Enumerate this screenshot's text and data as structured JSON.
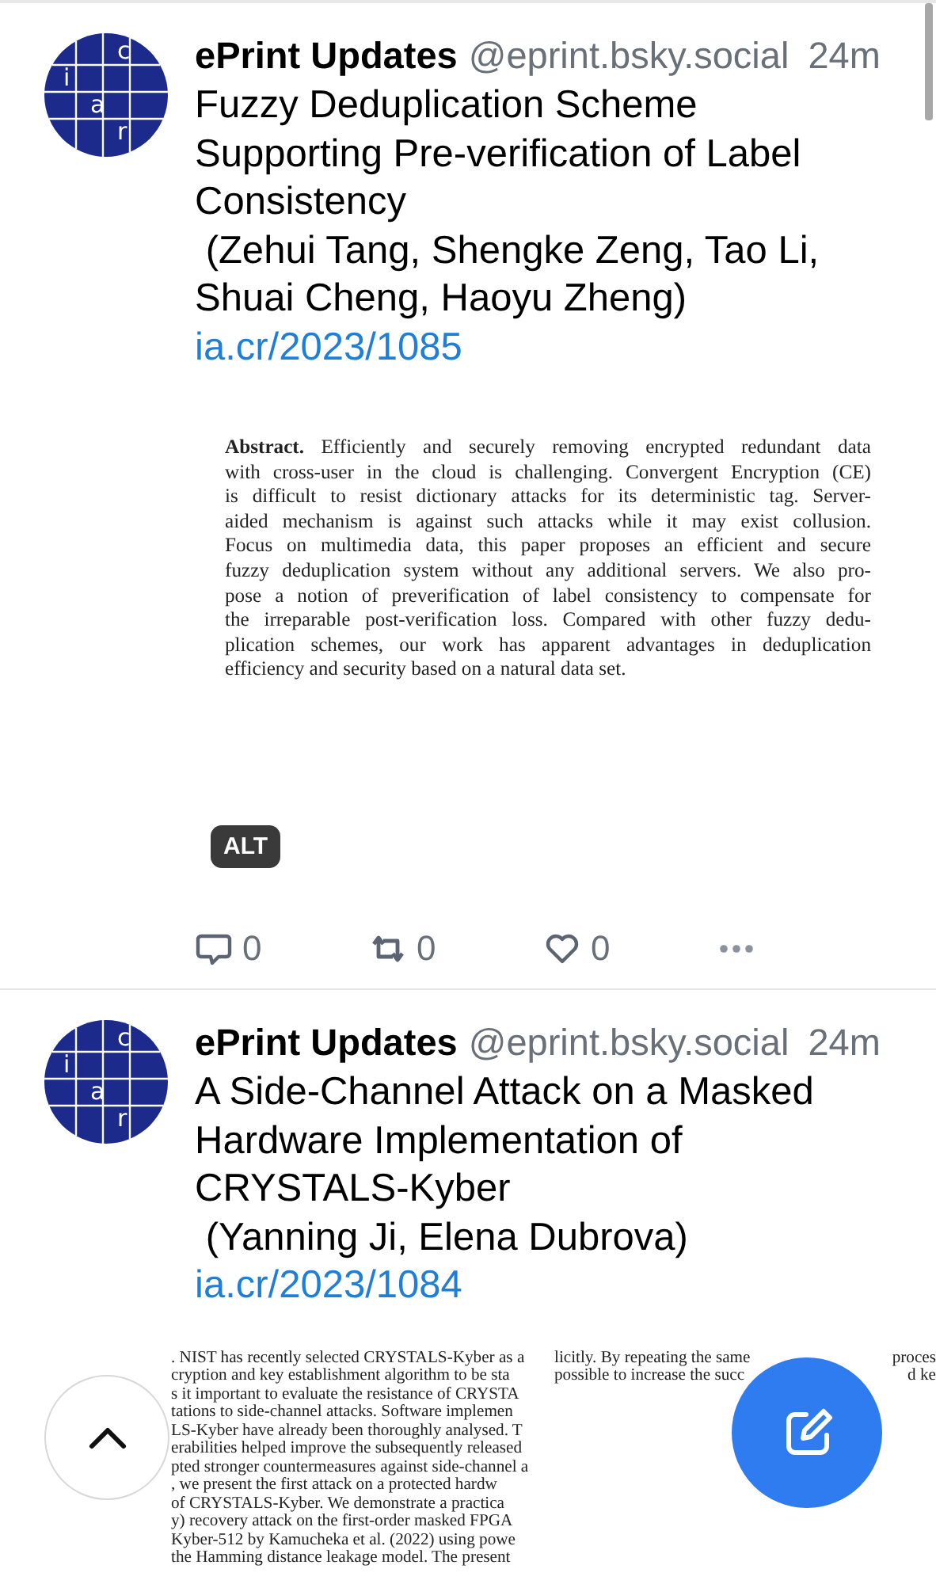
{
  "posts": [
    {
      "author": "ePrint Updates",
      "handle": "@eprint.bsky.social",
      "time": "24m",
      "avatar_letters": [
        "c",
        "i",
        "a",
        "r"
      ],
      "text": "Fuzzy Deduplication Scheme Supporting Pre-verification of Label Consistency\n (Zehui Tang, Shengke Zeng, Tao Li, Shuai Cheng, Haoyu Zheng) ",
      "link": "ia.cr/2023/1085",
      "image": {
        "kind": "abstract",
        "lines": [
          "**Abstract.** Efficiently and securely removing encrypted redundant data",
          "with cross-user in the cloud is challenging. Convergent Encryption (CE)",
          "is difficult to resist dictionary attacks for its deterministic tag. Server-",
          "aided mechanism is against such attacks while it may exist collusion.",
          "Focus on multimedia data, this paper proposes an efficient and secure",
          "fuzzy deduplication system without any additional servers. We also pro-",
          "pose a notion of preverification of label consistency to compensate for",
          "the irreparable post-verification loss. Compared with other fuzzy dedu-",
          "plication schemes, our work has apparent advantages in deduplication",
          "efficiency and security based on a natural data set."
        ]
      },
      "alt_badge": "ALT",
      "actions": [
        {
          "kind": "reply",
          "count": "0"
        },
        {
          "kind": "repost",
          "count": "0"
        },
        {
          "kind": "like",
          "count": "0"
        },
        {
          "kind": "more"
        }
      ]
    },
    {
      "author": "ePrint Updates",
      "handle": "@eprint.bsky.social",
      "time": "24m",
      "avatar_letters": [
        "c",
        "i",
        "a",
        "r"
      ],
      "text": "A Side-Channel Attack on a Masked Hardware Implementation of CRYSTALS-Kyber\n (Yanning Ji, Elena Dubrova) ",
      "link": "ia.cr/2023/1084",
      "image": {
        "kind": "two_column",
        "left_lines": [
          ". NIST has recently selected CRYSTALS-Kyber as a",
          "cryption and key establishment algorithm to be sta",
          "s it important to evaluate the resistance of CRYSTA",
          "tations to side-channel attacks. Software implemen",
          "LS-Kyber have already been thoroughly analysed. T",
          "erabilities helped improve the subsequently released",
          "pted stronger countermeasures against side-channel a",
          ", we present the first attack on a protected hardw",
          "of CRYSTALS-Kyber. We demonstrate a practica",
          "y) recovery attack on the first-order masked FPGA",
          "Kyber-512 by Kamucheka et al. (2022) using powe",
          "the Hamming distance leakage model. The present"
        ],
        "right_lines": [
          [
            "licitly. By repeating the same",
            "proces"
          ],
          [
            "possible to increase the succ",
            "d ke"
          ]
        ]
      }
    }
  ]
}
